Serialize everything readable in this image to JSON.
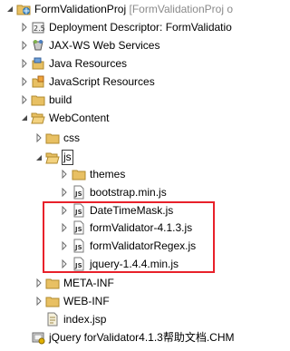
{
  "project": {
    "name": "FormValidationProj",
    "suffix": "[FormValidationProj o"
  },
  "items": [
    {
      "label": "Deployment Descriptor: FormValidatio",
      "icon": "deployment-descriptor-icon"
    },
    {
      "label": "JAX-WS Web Services",
      "icon": "web-services-icon"
    },
    {
      "label": "Java Resources",
      "icon": "java-resources-icon"
    },
    {
      "label": "JavaScript Resources",
      "icon": "javascript-resources-icon"
    },
    {
      "label": "build",
      "icon": "folder-icon"
    },
    {
      "label": "WebContent",
      "icon": "folder-icon"
    },
    {
      "label": "css",
      "icon": "folder-icon"
    },
    {
      "label": "js",
      "icon": "folder-icon"
    },
    {
      "label": "themes",
      "icon": "folder-icon"
    },
    {
      "label": "bootstrap.min.js",
      "icon": "js-file-icon"
    },
    {
      "label": "DateTimeMask.js",
      "icon": "js-file-icon"
    },
    {
      "label": "formValidator-4.1.3.js",
      "icon": "js-file-icon"
    },
    {
      "label": "formValidatorRegex.js",
      "icon": "js-file-icon"
    },
    {
      "label": "jquery-1.4.4.min.js",
      "icon": "js-file-icon"
    },
    {
      "label": "META-INF",
      "icon": "folder-icon"
    },
    {
      "label": "WEB-INF",
      "icon": "folder-icon"
    },
    {
      "label": "index.jsp",
      "icon": "jsp-file-icon"
    },
    {
      "label": "jQuery forValidator4.1.3帮助文档.CHM",
      "icon": "chm-file-icon"
    }
  ],
  "colors": {
    "highlight": "#e8212a",
    "folder": "#e8c063",
    "selection_border": "#3a3a3a"
  }
}
